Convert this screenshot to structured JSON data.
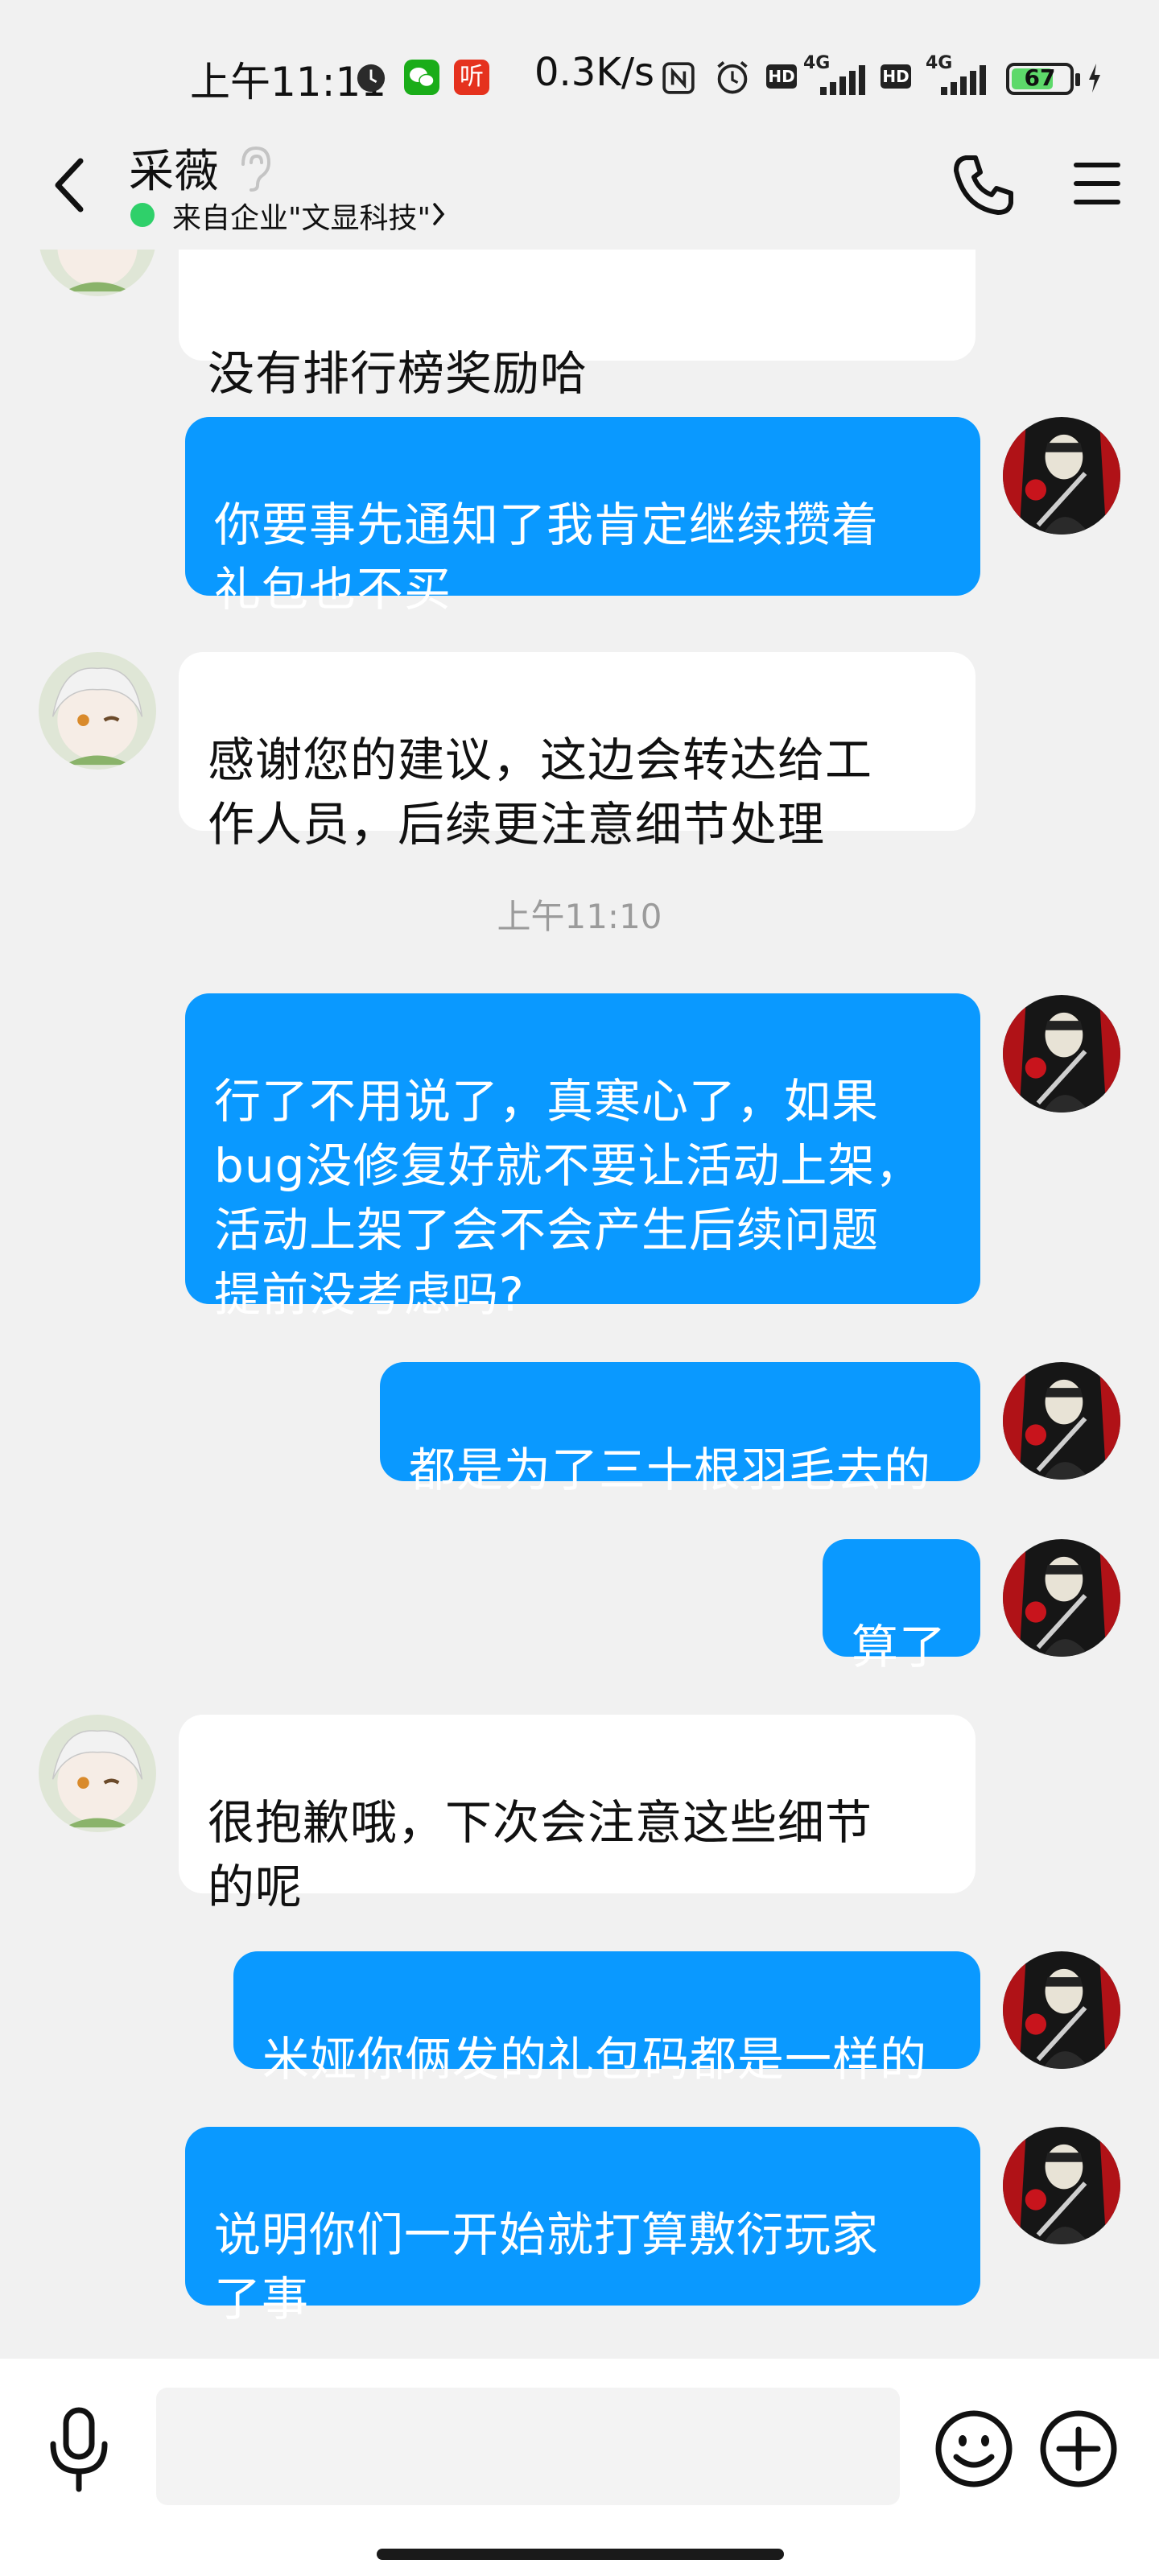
{
  "status_bar": {
    "time": "上午11:11",
    "net_speed": "0.3K/s",
    "notification_icons": [
      "clock-app-icon",
      "wechat-icon",
      "listen-app-icon"
    ],
    "app_badge_text": "听",
    "network_labels": [
      "HD",
      "4G",
      "HD",
      "4G"
    ],
    "battery_level": "67",
    "accent_wechat": "#1aad19",
    "accent_listen": "#e5321e"
  },
  "header": {
    "contact_name": "采薇",
    "company_label": "来自企业\"文显科技\"",
    "online_color": "#2fd06a"
  },
  "messages": [
    {
      "id": "m0",
      "side": "in",
      "text": "没有排行榜奖励哈",
      "partial": true
    },
    {
      "id": "m1",
      "side": "out",
      "text": "你要事先通知了我肯定继续攒着\n礼包也不买"
    },
    {
      "id": "m2",
      "side": "in",
      "text": "感谢您的建议，这边会转达给工\n作人员，后续更注意细节处理"
    },
    {
      "id": "m3",
      "side": "out",
      "text": "行了不用说了，真寒心了，如果\nbug没修复好就不要让活动上架，\n活动上架了会不会产生后续问题\n提前没考虑吗?"
    },
    {
      "id": "m4",
      "side": "out",
      "text": "都是为了三十根羽毛去的"
    },
    {
      "id": "m5",
      "side": "out",
      "text": "算了"
    },
    {
      "id": "m6",
      "side": "in",
      "text": "很抱歉哦，下次会注意这些细节\n的呢"
    },
    {
      "id": "m7",
      "side": "out",
      "text": "米娅你俩发的礼包码都是一样的"
    },
    {
      "id": "m8",
      "side": "out",
      "text": "说明你们一开始就打算敷衍玩家\n了事"
    }
  ],
  "timestamp": "上午11:10",
  "colors": {
    "outgoing_bubble": "#0a99ff",
    "incoming_bubble": "#ffffff",
    "background": "#f1f1f1"
  },
  "input_bar": {
    "placeholder": ""
  }
}
